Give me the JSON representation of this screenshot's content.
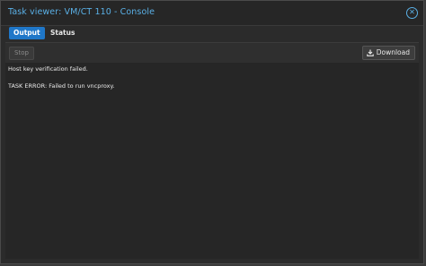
{
  "window": {
    "title": "Task viewer: VM/CT 110 - Console",
    "close_icon": "close-circle-icon"
  },
  "tabs": [
    {
      "label": "Output",
      "active": true
    },
    {
      "label": "Status",
      "active": false
    }
  ],
  "toolbar": {
    "stop_label": "Stop",
    "download_label": "Download",
    "download_icon": "download-icon"
  },
  "console": {
    "lines": [
      "Host key verification failed.",
      "TASK ERROR: Failed to run vncproxy."
    ]
  },
  "colors": {
    "accent": "#5ab0e6",
    "active_tab": "#1f77c8",
    "background": "#2b2b2b"
  }
}
